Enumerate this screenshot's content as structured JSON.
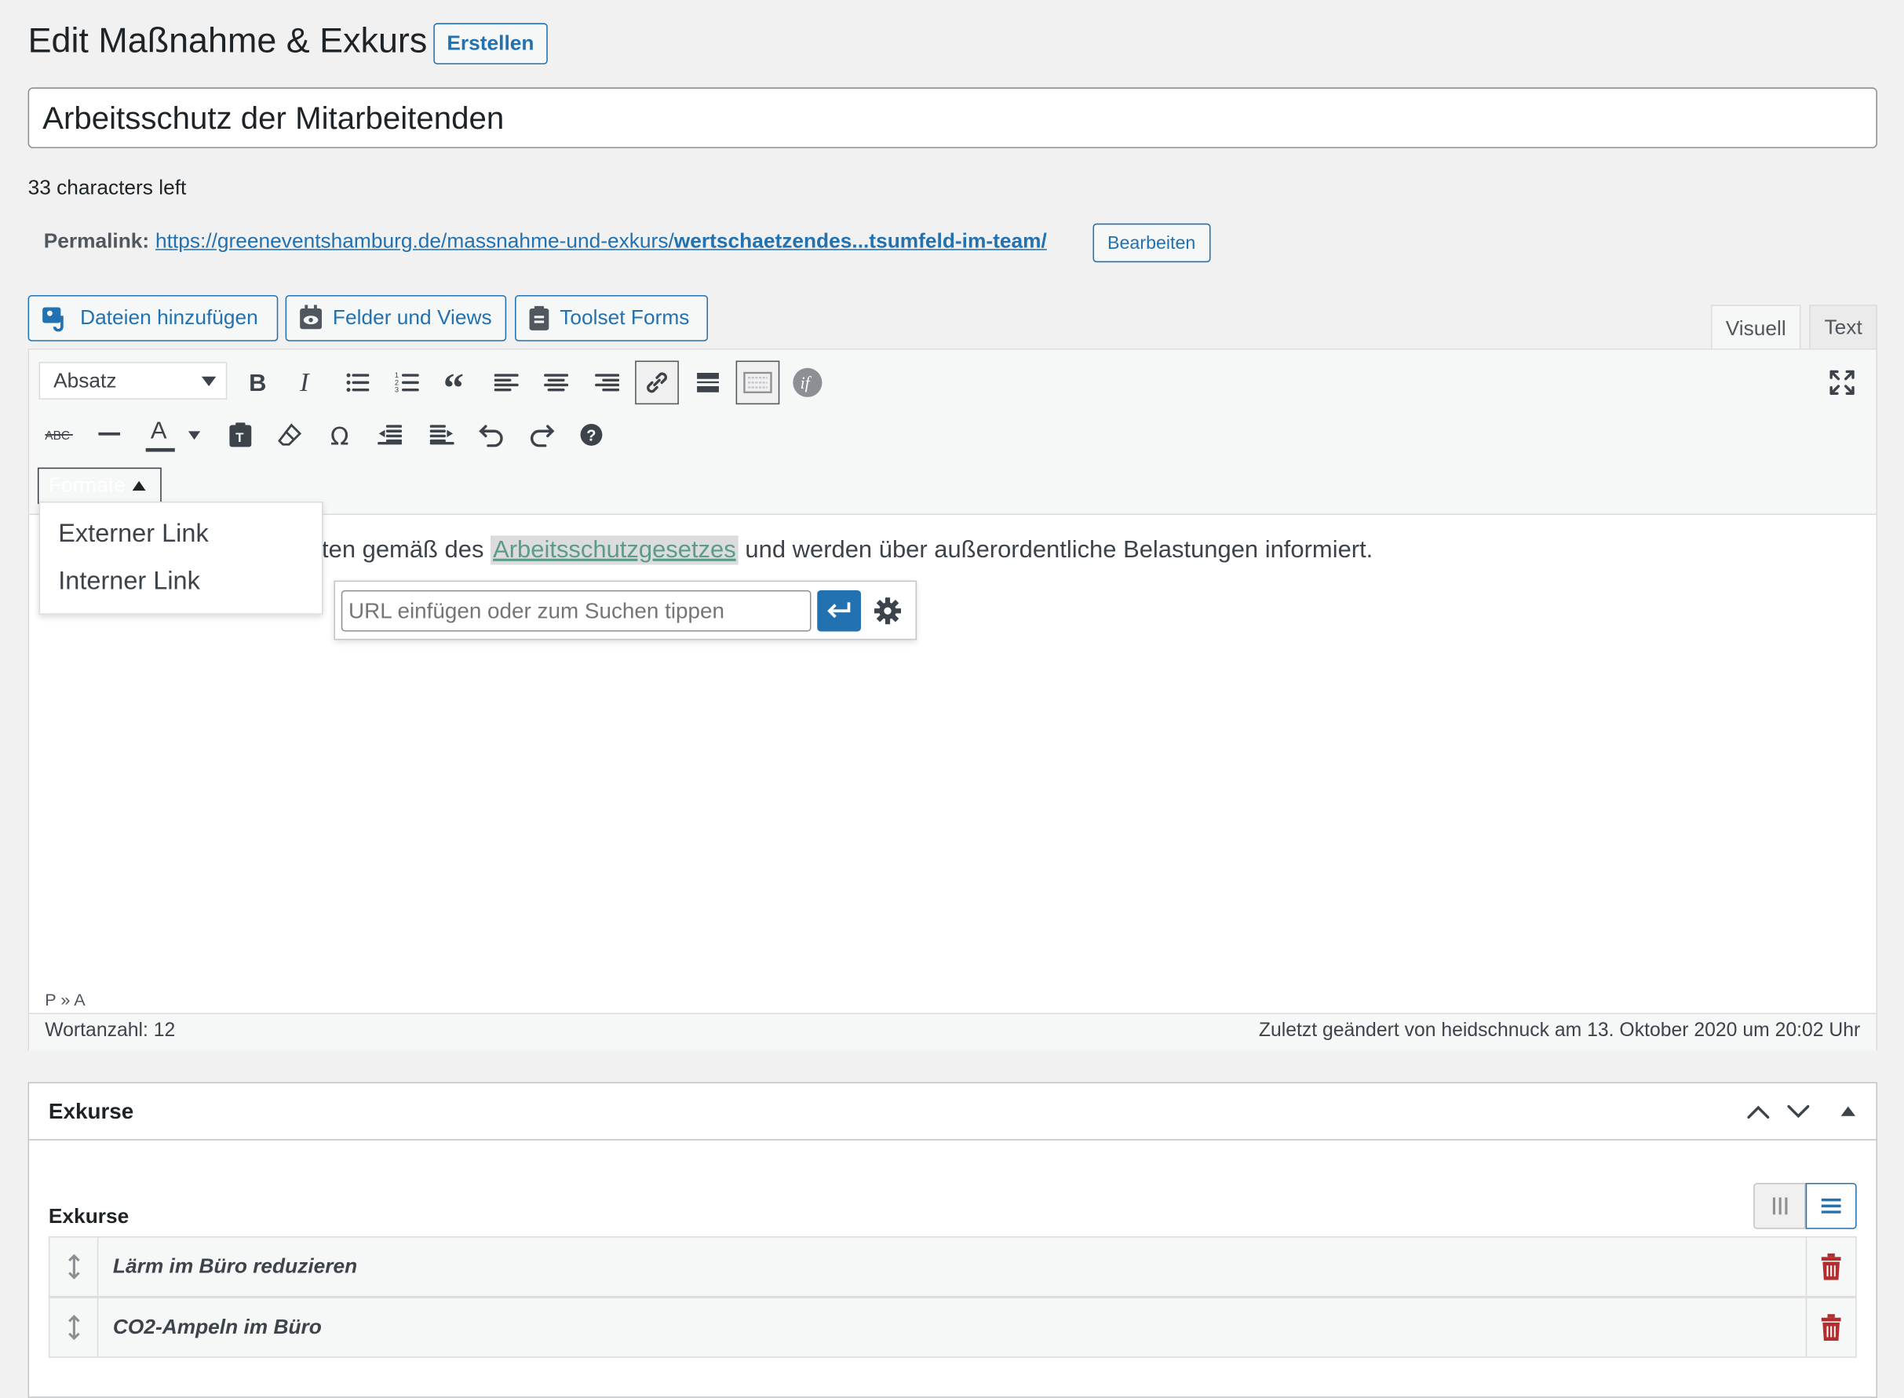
{
  "header": {
    "title": "Edit Maßnahme & Exkurs",
    "create_label": "Erstellen"
  },
  "post_title": {
    "value": "Arbeitsschutz der Mitarbeitenden",
    "chars_left": "33 characters left"
  },
  "permalink": {
    "label": "Permalink:",
    "url_base": "https://greeneventshamburg.de/massnahme-und-exkurs/",
    "slug": "wertschaetzendes...tsumfeld-im-team/",
    "edit_label": "Bearbeiten"
  },
  "media_buttons": {
    "add_files": "Dateien hinzufügen",
    "fields_views": "Felder und Views",
    "toolset_forms": "Toolset Forms"
  },
  "editor_tabs": {
    "visual": "Visuell",
    "text": "Text"
  },
  "toolbar": {
    "format_select": "Absatz",
    "formats_button": "Formate",
    "text_color_letter": "A"
  },
  "formats_menu": {
    "items": [
      "Externer Link",
      "Interner Link"
    ]
  },
  "content": {
    "before": "ten gemäß des ",
    "link": "Arbeitsschutzgesetzes",
    "after": " und werden über außerordentliche Belastungen informiert."
  },
  "link_popup": {
    "placeholder": "URL einfügen oder zum Suchen tippen"
  },
  "status": {
    "path": "P » A",
    "word_count": "Wortanzahl: 12",
    "last_modified": "Zuletzt geändert von heidschnuck am 13. Oktober 2020 um 20:02 Uhr"
  },
  "exkurse_box": {
    "title": "Exkurse",
    "field_label": "Exkurse",
    "items": [
      "Lärm im Büro reduzieren",
      "CO2-Ampeln im Büro"
    ]
  },
  "colors": {
    "accent": "#2271b1",
    "delete": "#b32d2e",
    "link_highlight": "#5a9b8c"
  }
}
